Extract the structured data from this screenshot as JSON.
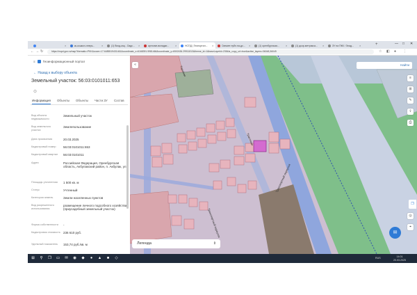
{
  "browser": {
    "tabs": [
      {
        "title": "",
        "color": "#4285f4",
        "active": false
      },
      {
        "title": "кк-кошкоч-энерь...",
        "color": "#3c78d8",
        "active": false
      },
      {
        "title": "(1) Вход-мщ - Свдс...",
        "color": "#888888",
        "active": false
      },
      {
        "title": "аргэомп-вкладки...",
        "color": "#cc3333",
        "active": false
      },
      {
        "title": "НСПД | Геопортал...",
        "color": "#3b82f6",
        "active": true
      },
      {
        "title": "Свежее публ.на-дс...",
        "color": "#cc3333",
        "active": false
      },
      {
        "title": "(1) оренбургская...",
        "color": "#888888",
        "active": false
      },
      {
        "title": "(1) дозр-метрикса...",
        "color": "#888888",
        "active": false
      },
      {
        "title": "ЗУ на ПКК / Элад...",
        "color": "#888888",
        "active": false
      }
    ],
    "new_tab": "+",
    "url": "https://nspd.gov.ru/map?thematic=PKK&zoom=17.6485519431461&coordinate_x=6168391.5981466&coordinate_y=6502436.29911813&theme_id=1&baseLayerId=235&is_copy_url=true&active_layers=36048,36049",
    "nav": {
      "back": "←",
      "forward": "→",
      "reload": "↻"
    },
    "window": {
      "min": "—",
      "max": "□",
      "close": "✕"
    }
  },
  "panel": {
    "brand": "Геоинформационный портал",
    "back_link": "← Назад к выбору объекта",
    "title": "Земельный участок: 56:03:0101011:653",
    "tabs": [
      "Информация",
      "Объекты",
      "Объекты",
      "Части ЗУ",
      "Состав"
    ],
    "active_tab": 0,
    "fields": [
      {
        "key": "Вид объекта недвижимости",
        "value": "Земельный участок"
      },
      {
        "key": "Вид земельного участка",
        "value": "Землепользование"
      },
      {
        "key": "Дата присвоения",
        "value": "20.03.2025"
      },
      {
        "key": "Кадастровый номер",
        "value": "56:03:0101011:653"
      },
      {
        "key": "Кадастровый квартал",
        "value": "56:03:0101011"
      },
      {
        "key": "Адрес",
        "value": "Российская Федерация, Оренбургская область, Акбулакский район, п. Акбулак, ул."
      },
      {
        "key": "Площадь уточненная",
        "value": "1 500 кв. м"
      },
      {
        "key": "Статус",
        "value": "Учтенный"
      },
      {
        "key": "Категория земель",
        "value": "Земли населенных пунктов"
      },
      {
        "key": "Вид разрешенного использования",
        "value": "размещение личного подсобного хозяйства (приусадебный земельный участок)"
      },
      {
        "key": "Форма собственности",
        "value": "-"
      },
      {
        "key": "Кадастровая стоимость",
        "value": "236 610 руб."
      },
      {
        "key": "Удельный показатель",
        "value": "153,74 руб./кв. м"
      }
    ]
  },
  "map": {
    "search_label": "Найти",
    "legend_label": "Легенда",
    "streets": [
      "Торговая",
      "Трактовая",
      "Транспортный переулок"
    ],
    "colors": {
      "parcel": "#f1c6cc",
      "selected": "#d46bd0",
      "road": "#7f9ee8",
      "green": "#7fbf8a",
      "dark": "#8a7a6d"
    }
  },
  "taskbar": {
    "tray": [
      "RUS",
      "14:01",
      "20.03.2025"
    ]
  }
}
